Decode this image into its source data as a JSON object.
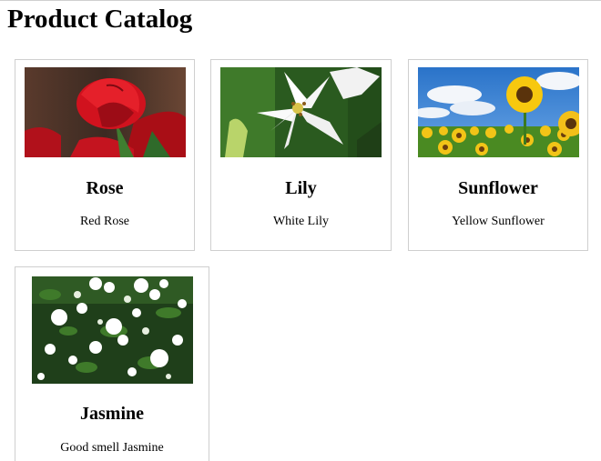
{
  "page": {
    "title": "Product Catalog"
  },
  "products": [
    {
      "name": "Rose",
      "description": "Red Rose",
      "image": "rose-photo"
    },
    {
      "name": "Lily",
      "description": "White Lily",
      "image": "lily-photo"
    },
    {
      "name": "Sunflower",
      "description": "Yellow Sunflower",
      "image": "sunflower-photo"
    },
    {
      "name": "Jasmine",
      "description": "Good smell Jasmine",
      "image": "jasmine-photo"
    }
  ]
}
